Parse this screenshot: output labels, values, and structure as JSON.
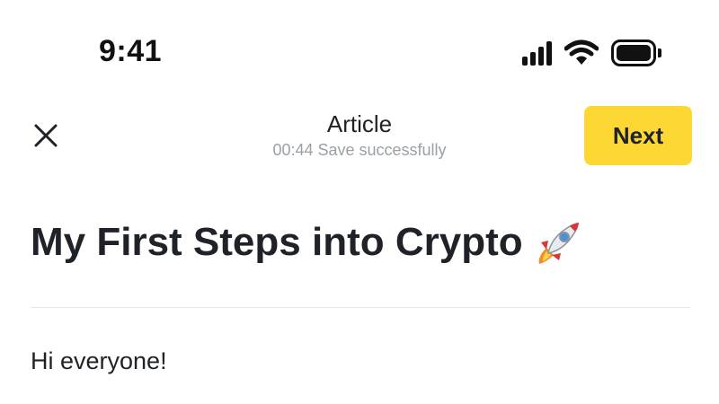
{
  "status_bar": {
    "time": "9:41",
    "icons": [
      "cellular-signal-icon",
      "wifi-icon",
      "battery-icon"
    ]
  },
  "header": {
    "close_icon": "close-icon",
    "title": "Article",
    "subtitle": "00:44 Save successfully",
    "next_label": "Next"
  },
  "article": {
    "title": "My First Steps into Crypto",
    "title_emoji_icon": "rocket-icon",
    "body": "Hi everyone!"
  },
  "colors": {
    "accent": "#fdd835",
    "text": "#1f2228",
    "muted": "#9aa0a6",
    "divider": "#e3e5e8"
  }
}
